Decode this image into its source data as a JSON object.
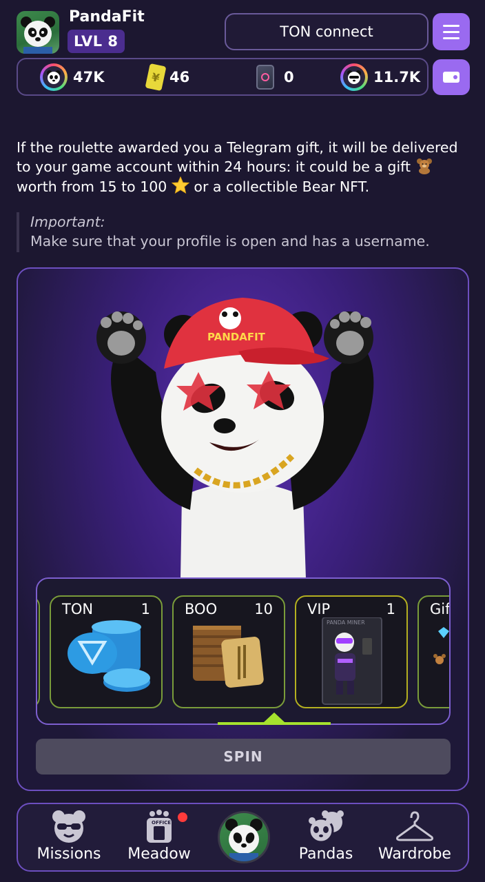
{
  "header": {
    "app_name": "PandaFit",
    "level_label": "LVL 8",
    "ton_connect_label": "TON connect"
  },
  "stats": {
    "panda_coins": "47K",
    "tickets": "46",
    "cards": "0",
    "rainbow_coins": "11.7K"
  },
  "info": {
    "line_before_bear": "If the roulette awarded you a Telegram gift, it will be delivered to your game account within 24 hours: it could be a gift",
    "line_mid": "worth from 15 to 100",
    "line_after_star": "or a collectible Bear NFT.",
    "note_title": "Important:",
    "note_body": "Make sure that your profile is open and has a username."
  },
  "roulette": {
    "prizes": [
      {
        "name": "TON",
        "qty": "1",
        "border": "#7a9c3a"
      },
      {
        "name": "BOO",
        "qty": "10",
        "border": "#7a9c3a"
      },
      {
        "name": "VIP",
        "qty": "1",
        "border": "#b4b020"
      },
      {
        "name": "Gif",
        "qty": "",
        "border": "#7a9c3a"
      }
    ],
    "cap_text": "PANDAFIT",
    "vip_card_text": "PANDA MINER",
    "spin_label": "SPIN"
  },
  "nav": {
    "items": [
      {
        "label": "Missions",
        "icon": "panda-sunglasses-icon"
      },
      {
        "label": "Meadow",
        "icon": "office-icon"
      },
      {
        "label": "",
        "icon": "panda-avatar"
      },
      {
        "label": "Pandas",
        "icon": "pandas-icon"
      },
      {
        "label": "Wardrobe",
        "icon": "hanger-icon"
      }
    ]
  },
  "colors": {
    "background": "#1c1730",
    "accent": "#9a6af0",
    "pointer": "#a6e22e",
    "notification": "#ff3b3b"
  }
}
